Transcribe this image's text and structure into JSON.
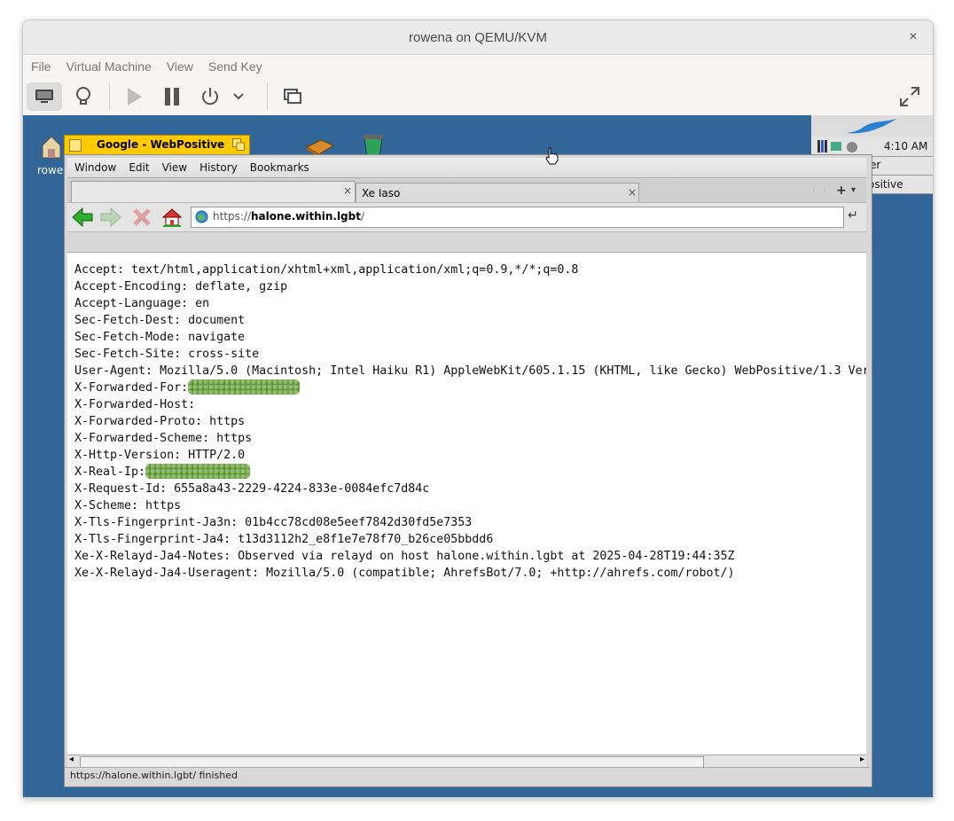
{
  "vm": {
    "title": "rowena on QEMU/KVM",
    "close": "×",
    "menu": [
      "File",
      "Virtual Machine",
      "View",
      "Send Key"
    ]
  },
  "desktop": {
    "icon_label": "rowe",
    "deskbar": {
      "clock": "4:10 AM",
      "items": [
        "er",
        "ositive"
      ]
    }
  },
  "webpositive": {
    "window_title": "Google - WebPositive",
    "menu": [
      "Window",
      "Edit",
      "View",
      "History",
      "Bookmarks"
    ],
    "tabs": [
      {
        "label": "",
        "close": "×"
      },
      {
        "label": "Xe Iaso",
        "close": "×"
      }
    ],
    "url_prefix": "https://",
    "url_host": "halone.within.lgbt",
    "url_path": "/",
    "status": "https://halone.within.lgbt/ finished",
    "headers": [
      "Accept: text/html,application/xhtml+xml,application/xml;q=0.9,*/*;q=0.8",
      "Accept-Encoding: deflate, gzip",
      "Accept-Language: en",
      "Sec-Fetch-Dest: document",
      "Sec-Fetch-Mode: navigate",
      "Sec-Fetch-Site: cross-site",
      "User-Agent: Mozilla/5.0 (Macintosh; Intel Haiku R1) AppleWebKit/605.1.15 (KHTML, like Gecko) WebPositive/1.3 Ver",
      "X-Forwarded-For:",
      "X-Forwarded-Host:",
      "X-Forwarded-Proto: https",
      "X-Forwarded-Scheme: https",
      "X-Http-Version: HTTP/2.0",
      "X-Real-Ip:",
      "X-Request-Id: 655a8a43-2229-4224-833e-0084efc7d84c",
      "X-Scheme: https",
      "X-Tls-Fingerprint-Ja3n: 01b4cc78cd08e5eef7842d30fd5e7353",
      "X-Tls-Fingerprint-Ja4: t13d3112h2_e8f1e7e78f70_b26ce05bbdd6",
      "Xe-X-Relayd-Ja4-Notes: Observed via relayd on host halone.within.lgbt at 2025-04-28T19:44:35Z",
      "Xe-X-Relayd-Ja4-Useragent: Mozilla/5.0 (compatible; AhrefsBot/7.0; +http://ahrefs.com/robot/)"
    ]
  },
  "colors": {
    "desktop": "#336698",
    "window_tab": "#ffcb00"
  }
}
